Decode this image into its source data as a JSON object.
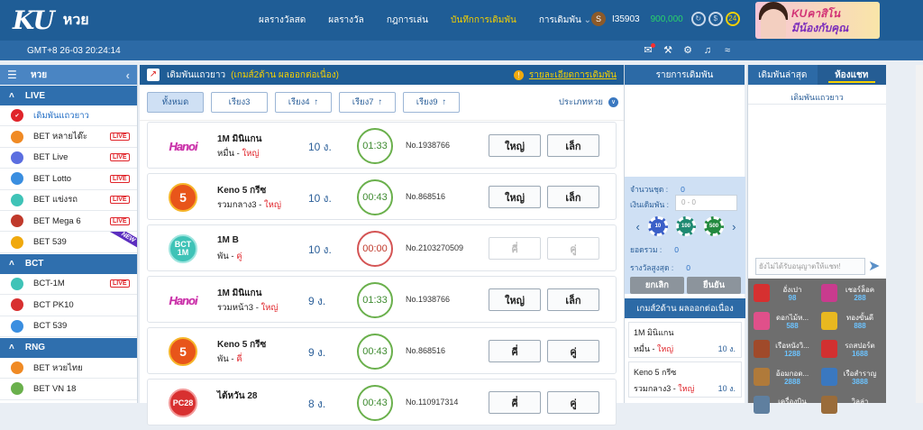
{
  "header": {
    "logo_ku": "KU",
    "logo_label": "หวย",
    "nav": [
      "ผลรางวัลสด",
      "ผลรางวัล",
      "กฎการเล่น",
      "บันทึกการเดิมพัน",
      "การเดิมพัน"
    ],
    "nav_active_index": 3,
    "user_id": "I35903",
    "balance": "900,000",
    "badge_count": "24",
    "banner_line1": "KUคาสิโน",
    "banner_line2": "มีน้องกับคุณ"
  },
  "subbar": {
    "datetime": "GMT+8 26-03 20:24:14"
  },
  "sidebar": {
    "title": "หวย",
    "sections": [
      {
        "name": "LIVE",
        "items": [
          {
            "label": "เดิมพันแถวยาว",
            "active": true,
            "live": false,
            "icon": "check-badge-icon",
            "color": "#e0242a"
          },
          {
            "label": "BET หลายได๊ะ",
            "live": true,
            "icon": "game-icon",
            "color": "#f08a24"
          },
          {
            "label": "BET Live",
            "live": true,
            "icon": "live-icon",
            "color": "#5b6ee0"
          },
          {
            "label": "BET Lotto",
            "live": true,
            "icon": "lotto-icon",
            "color": "#3a8ee0"
          },
          {
            "label": "BET แข่งรถ",
            "live": true,
            "icon": "car-icon",
            "color": "#3fc3b7"
          },
          {
            "label": "BET Mega 6",
            "live": true,
            "icon": "mega6-icon",
            "color": "#c0392b"
          },
          {
            "label": "BET 539",
            "live": false,
            "new": true,
            "icon": "539-icon",
            "color": "#f0a90e"
          }
        ]
      },
      {
        "name": "BCT",
        "items": [
          {
            "label": "BCT-1M",
            "live": true,
            "icon": "bct-icon",
            "color": "#3fc3b7"
          },
          {
            "label": "BCT PK10",
            "live": false,
            "icon": "pk10-icon",
            "color": "#d83030"
          },
          {
            "label": "BCT 539",
            "live": false,
            "icon": "539-icon",
            "color": "#3a8ee0"
          }
        ]
      },
      {
        "name": "RNG",
        "items": [
          {
            "label": "BET หวยไทย",
            "live": false,
            "icon": "thai-icon",
            "color": "#f08a24"
          },
          {
            "label": "BET VN 18",
            "live": false,
            "icon": "vn18-icon",
            "color": "#6ab04c"
          }
        ]
      }
    ],
    "live_tag": "LIVE",
    "new_tag": "NEW"
  },
  "main": {
    "title": "เดิมพันแถวยาว",
    "subtitle": "(เกมส์2ด้าน ผลออกต่อเนื่อง)",
    "detail_link": "รายละเอียดการเดิมพัน",
    "filters": [
      {
        "label": "ทั้งหมด",
        "arrow": "",
        "active": true
      },
      {
        "label": "เรียง3",
        "arrow": ""
      },
      {
        "label": "เรียง4",
        "arrow": "↑"
      },
      {
        "label": "เรียง7",
        "arrow": "↑"
      },
      {
        "label": "เรียง9",
        "arrow": "↑"
      }
    ],
    "type_label": "ประเภทหวย",
    "games": [
      {
        "logo": "hanoi",
        "logo_text": "Hanoi",
        "name": "1M มินิแกน",
        "sub_prefix": "หมื่น - ",
        "sub_value": "ใหญ่",
        "streak": "10 ง.",
        "timer": "01:33",
        "timer_red": false,
        "no": "No.1938766",
        "btn1": "ใหญ่",
        "btn2": "เล็ก",
        "disabled": false
      },
      {
        "logo": "keno",
        "logo_text": "5",
        "name": "Keno 5 กรีซ",
        "sub_prefix": "รวมกลาง3 - ",
        "sub_value": "ใหญ่",
        "streak": "10 ง.",
        "timer": "00:43",
        "timer_red": false,
        "no": "No.868516",
        "btn1": "ใหญ่",
        "btn2": "เล็ก",
        "disabled": false
      },
      {
        "logo": "bct",
        "logo_text": "BCT 1M",
        "name": "1M B",
        "sub_prefix": "พัน - ",
        "sub_value": "คู่",
        "streak": "10 ง.",
        "timer": "00:00",
        "timer_red": true,
        "no": "No.2103270509",
        "btn1": "คี่",
        "btn2": "คู่",
        "disabled": true
      },
      {
        "logo": "hanoi",
        "logo_text": "Hanoi",
        "name": "1M มินิแกน",
        "sub_prefix": "รวมหน้า3 - ",
        "sub_value": "ใหญ่",
        "streak": "9 ง.",
        "timer": "01:33",
        "timer_red": false,
        "no": "No.1938766",
        "btn1": "ใหญ่",
        "btn2": "เล็ก",
        "disabled": false
      },
      {
        "logo": "keno",
        "logo_text": "5",
        "name": "Keno 5 กรีซ",
        "sub_prefix": "พัน - ",
        "sub_value": "คี่",
        "streak": "9 ง.",
        "timer": "00:43",
        "timer_red": false,
        "no": "No.868516",
        "btn1": "คี่",
        "btn2": "คู่",
        "disabled": false
      },
      {
        "logo": "pk",
        "logo_text": "PC28",
        "name": "ไต้หวัน 28",
        "sub_prefix": "",
        "sub_value": "",
        "streak": "8 ง.",
        "timer": "00:43",
        "timer_red": false,
        "no": "No.110917314",
        "btn1": "คี่",
        "btn2": "คู่",
        "disabled": false
      }
    ]
  },
  "bet_panel": {
    "title": "รายการเดิมพัน",
    "count_label": "จำนวนชุด :",
    "count_value": "0",
    "amount_label": "เงินเดิมพัน :",
    "amount_placeholder": "0 - 0",
    "chips": [
      "10",
      "100",
      "500"
    ],
    "total_label": "ยอดรวม :",
    "total_value": "0",
    "maxwin_label": "รางวัลสูงสุด :",
    "maxwin_value": "0",
    "cancel_label": "ยกเลิก",
    "confirm_label": "ยืนยัน",
    "promo_title": "เกมส์2ด้าน ผลออกต่อเนื่อง",
    "mini": [
      {
        "name": "1M มินิแกน",
        "sub_prefix": "หมื่น - ",
        "sub_value": "ใหญ่",
        "count": "10 ง."
      },
      {
        "name": "Keno 5 กรีซ",
        "sub_prefix": "รวมกลาง3 - ",
        "sub_value": "ใหญ่",
        "count": "10 ง."
      }
    ]
  },
  "chat": {
    "tab1": "เดิมพันล่าสุด",
    "tab2": "ห้องแชท",
    "label": "เดิมพันแถวยาว",
    "input_placeholder": "ยังไม่ได้รับอนุญาตให้แชท!",
    "gifts": [
      {
        "name": "อั่งเปา",
        "price": "98",
        "color": "#d63030"
      },
      {
        "name": "เชอร์ล็อค",
        "price": "288",
        "color": "#c93b8e"
      },
      {
        "name": "ดอกไม้ห...",
        "price": "588",
        "color": "#e0508a"
      },
      {
        "name": "ทองขั้นดี",
        "price": "888",
        "color": "#e8b820"
      },
      {
        "name": "เรือหนังวิ...",
        "price": "1288",
        "color": "#a04a2a"
      },
      {
        "name": "รถสปอร์ต",
        "price": "1688",
        "color": "#d23030"
      },
      {
        "name": "อ้อมกอด...",
        "price": "2888",
        "color": "#b07a3a"
      },
      {
        "name": "เรือสำราญ",
        "price": "3888",
        "color": "#3a78c0"
      },
      {
        "name": "เครื่องบิน",
        "price": "",
        "color": "#5f7f9f"
      },
      {
        "name": "วิลล่า",
        "price": "",
        "color": "#9a6c3a"
      }
    ]
  }
}
